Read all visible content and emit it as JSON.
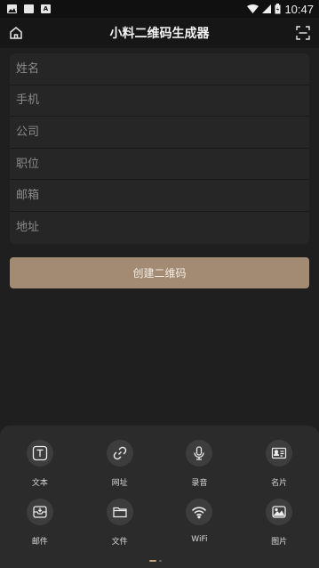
{
  "status_bar": {
    "time": "10:47"
  },
  "header": {
    "title": "小料二维码生成器"
  },
  "form": {
    "fields": [
      {
        "placeholder": "姓名",
        "value": ""
      },
      {
        "placeholder": "手机",
        "value": ""
      },
      {
        "placeholder": "公司",
        "value": ""
      },
      {
        "placeholder": "职位",
        "value": ""
      },
      {
        "placeholder": "邮箱",
        "value": ""
      },
      {
        "placeholder": "地址",
        "value": ""
      }
    ],
    "create_label": "创建二维码"
  },
  "tools": [
    {
      "label": "文本",
      "icon": "text-icon"
    },
    {
      "label": "网址",
      "icon": "link-icon"
    },
    {
      "label": "录音",
      "icon": "microphone-icon"
    },
    {
      "label": "名片",
      "icon": "business-card-icon"
    },
    {
      "label": "邮件",
      "icon": "email-icon"
    },
    {
      "label": "文件",
      "icon": "folder-icon"
    },
    {
      "label": "WiFi",
      "icon": "wifi-icon"
    },
    {
      "label": "图片",
      "icon": "image-icon"
    }
  ],
  "colors": {
    "accent": "#a38b73",
    "background": "#1f1f1f",
    "panel": "#2b2b2b"
  }
}
